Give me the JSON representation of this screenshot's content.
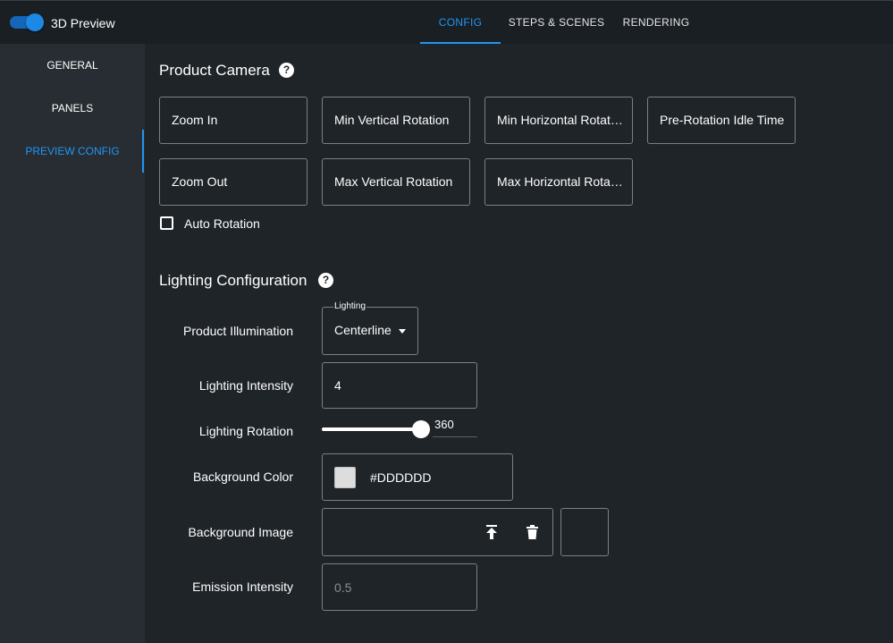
{
  "header": {
    "toggle_on": true,
    "title": "3D Preview",
    "tabs": [
      {
        "label": "CONFIG",
        "active": true
      },
      {
        "label": "STEPS & SCENES",
        "active": false
      },
      {
        "label": "RENDERING",
        "active": false
      }
    ]
  },
  "sidebar": {
    "items": [
      {
        "label": "GENERAL",
        "active": false
      },
      {
        "label": "PANELS",
        "active": false
      },
      {
        "label": "PREVIEW CONFIG",
        "active": true
      }
    ]
  },
  "product_camera": {
    "title": "Product Camera",
    "help_icon": "help-circle-icon",
    "buttons": [
      "Zoom In",
      "Min Vertical Rotation",
      "Min Horizontal Rotati…",
      "Pre-Rotation Idle Time",
      "Zoom Out",
      "Max Vertical Rotation",
      "Max Horizontal Rotati…"
    ],
    "auto_rotation": {
      "label": "Auto Rotation",
      "checked": false
    }
  },
  "lighting": {
    "title": "Lighting Configuration",
    "help_icon": "help-circle-icon",
    "product_illumination": {
      "label": "Product Illumination",
      "legend": "Lighting",
      "value": "Centerline"
    },
    "lighting_intensity": {
      "label": "Lighting Intensity",
      "value": "4"
    },
    "lighting_rotation": {
      "label": "Lighting Rotation",
      "value": "360"
    },
    "background_color": {
      "label": "Background Color",
      "value": "#DDDDDD",
      "swatch": "#dddddd"
    },
    "background_image": {
      "label": "Background Image",
      "upload_icon": "upload-icon",
      "delete_icon": "trash-icon"
    },
    "emission_intensity": {
      "label": "Emission Intensity",
      "placeholder": "0.5"
    }
  },
  "colors": {
    "accent": "#2196f3",
    "background": "#1f2428",
    "sidebar": "#272d32",
    "topbar": "#1a1f23"
  }
}
